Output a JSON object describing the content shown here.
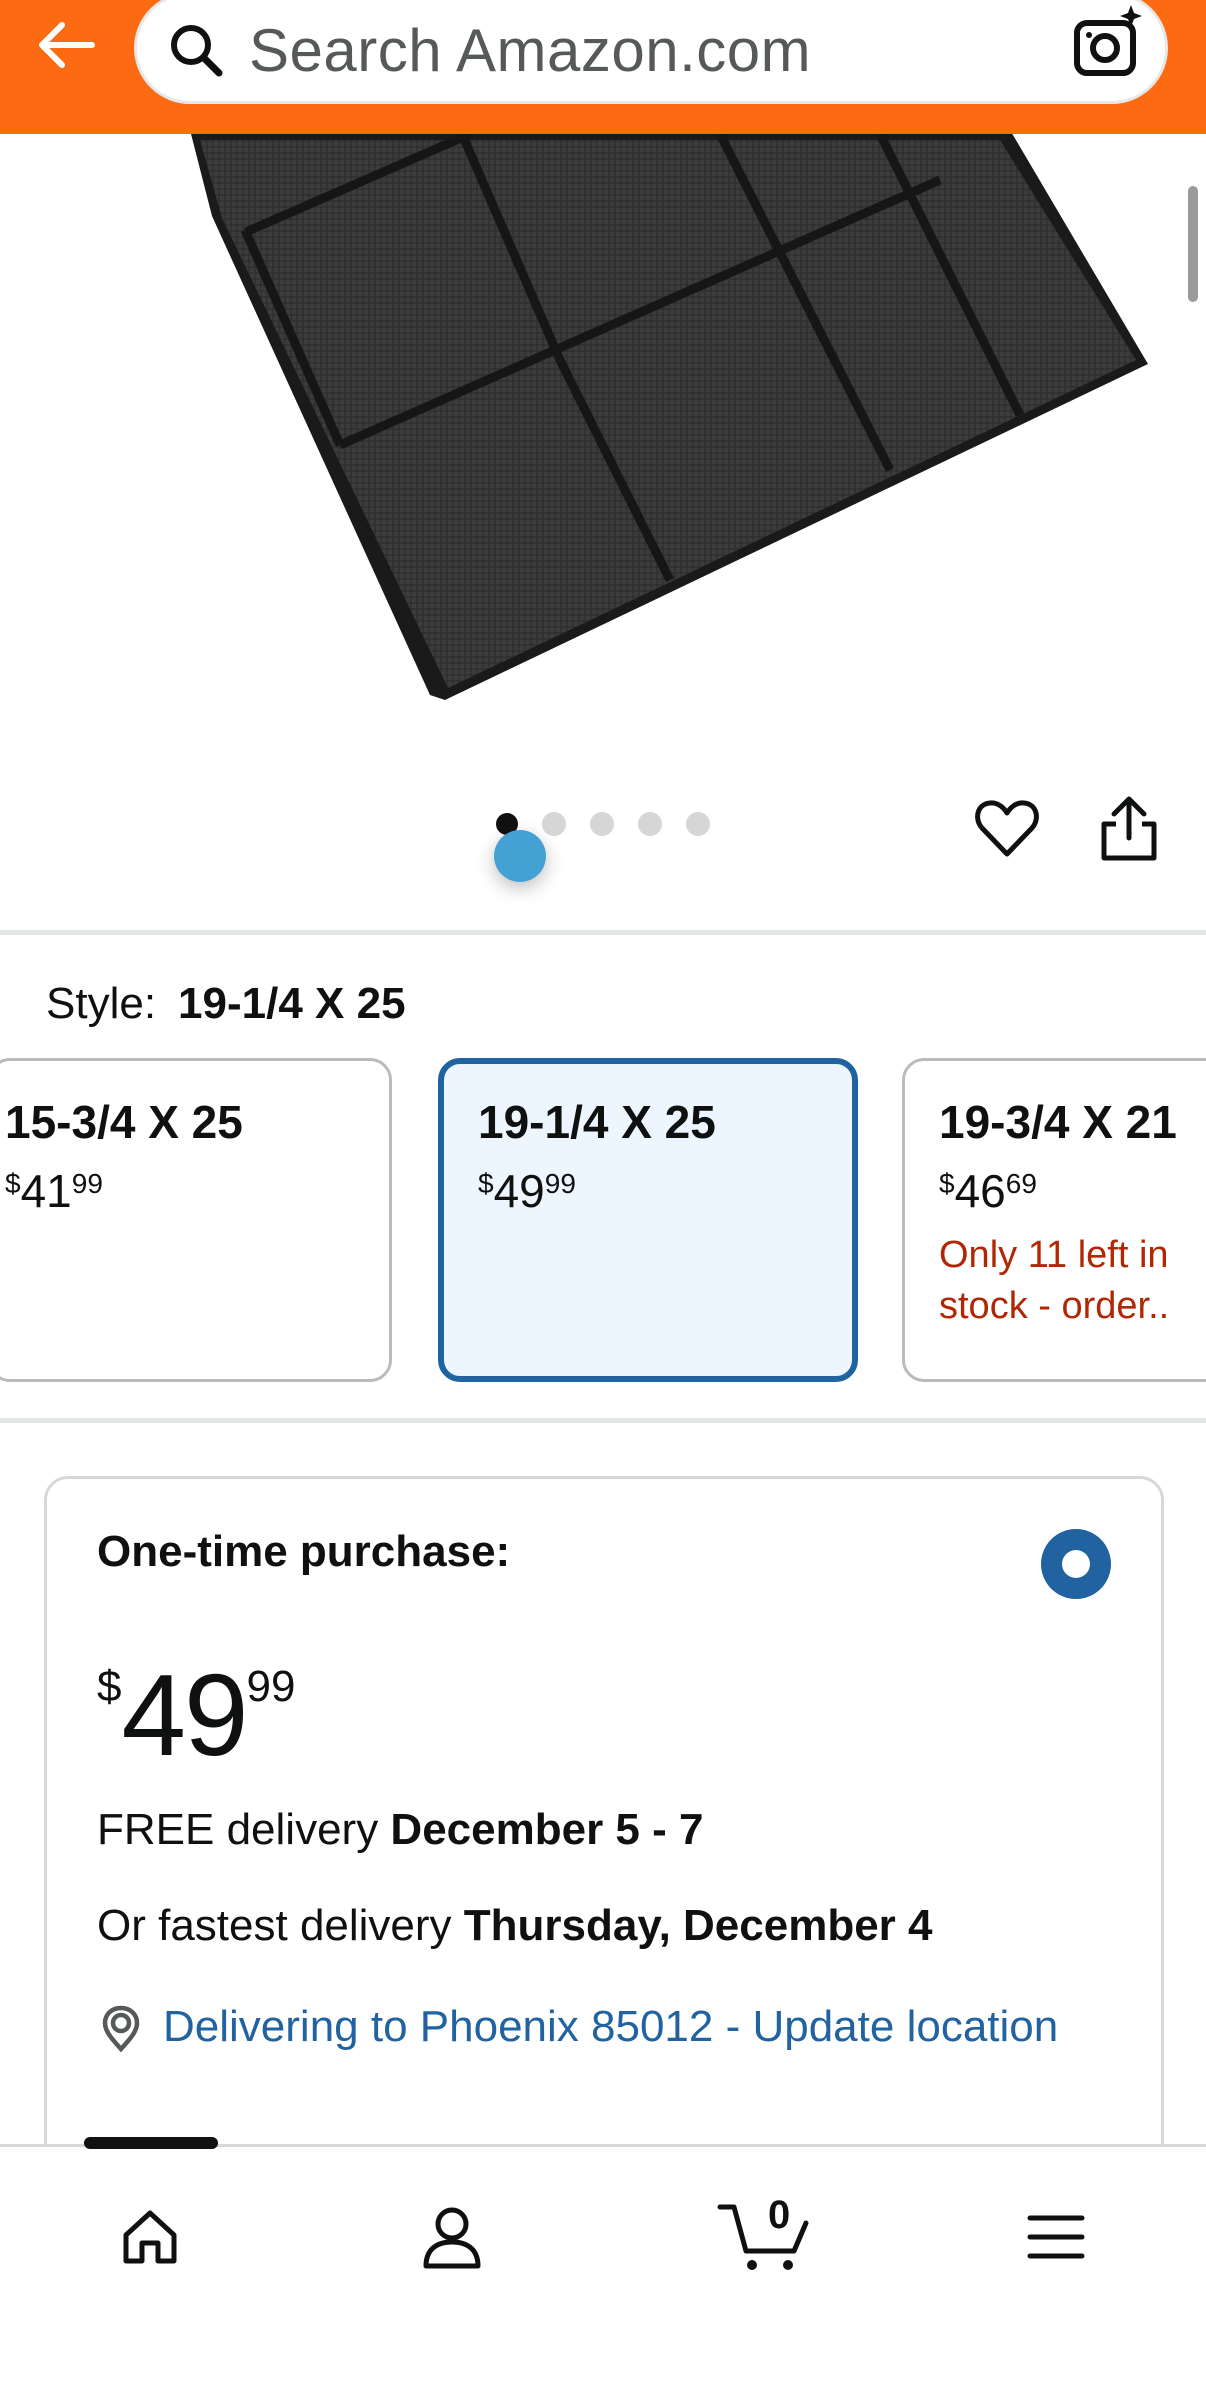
{
  "header": {
    "search_placeholder": "Search Amazon.com"
  },
  "image_carousel": {
    "total_images": 5,
    "active_index": 0
  },
  "style": {
    "label": "Style:",
    "selected_value": "19-1/4 X 25",
    "options": [
      {
        "name": "15-3/4 X 25",
        "price_symbol": "$",
        "price_whole": "41",
        "price_cents": "99",
        "stock": ""
      },
      {
        "name": "19-1/4 X 25",
        "price_symbol": "$",
        "price_whole": "49",
        "price_cents": "99",
        "stock": ""
      },
      {
        "name": "19-3/4 X 21",
        "price_symbol": "$",
        "price_whole": "46",
        "price_cents": "69",
        "stock": "Only 11 left in stock - order.."
      }
    ]
  },
  "purchase": {
    "title": "One-time purchase:",
    "price_symbol": "$",
    "price_whole": "49",
    "price_cents": "99",
    "free_delivery_prefix": "FREE delivery",
    "free_delivery_dates": "December 5 - 7",
    "fastest_prefix": "Or fastest delivery",
    "fastest_date": "Thursday, December 4",
    "location_text": "Delivering to Phoenix 85012 - Update location"
  },
  "cart": {
    "count": "0"
  },
  "colors": {
    "header_bg": "#fc6a12",
    "accent_blue": "#2162a1",
    "stock_red": "#b12704",
    "touch_indicator": "#45a1d4"
  }
}
